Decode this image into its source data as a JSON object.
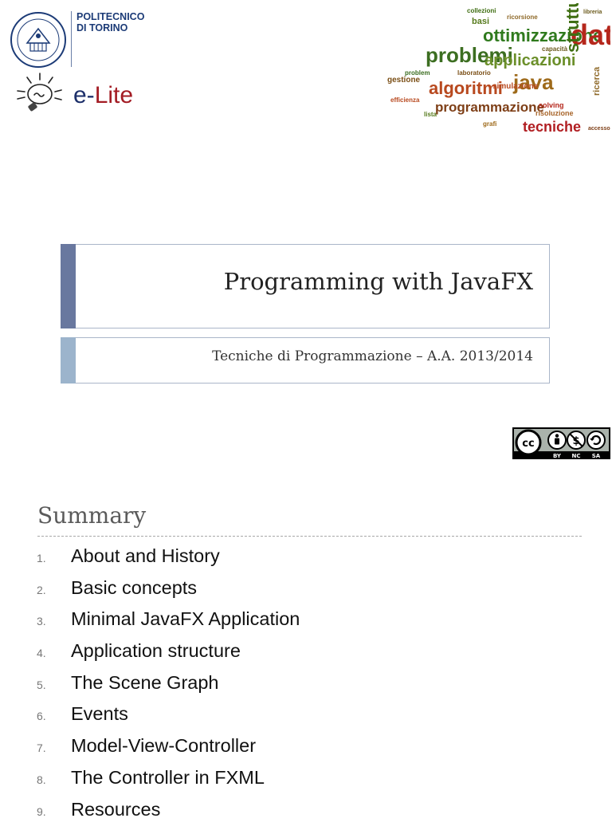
{
  "header": {
    "university_line1": "POLITECNICO",
    "university_line2": "DI TORINO",
    "group_prefix": "e-",
    "group_name": "Lite"
  },
  "word_cloud": {
    "words": [
      "ottimizzazione",
      "dati",
      "problemi",
      "applicazioni",
      "strutture",
      "algoritmi",
      "java",
      "programmazione",
      "tecniche",
      "basi",
      "gestione",
      "simulazione",
      "ricerca",
      "capacità",
      "laboratorio",
      "risoluzione",
      "problem",
      "solving",
      "lista",
      "accesso",
      "libreria",
      "grafi",
      "efficienza",
      "collezioni",
      "ricorsione"
    ]
  },
  "title": {
    "main": "Programming with JavaFX",
    "subtitle": "Tecniche di Programmazione – A.A. 2013/2014"
  },
  "license": {
    "cc": "cc",
    "by": "BY",
    "nc": "NC",
    "sa": "SA"
  },
  "summary": {
    "heading": "Summary",
    "items": [
      {
        "num": "1.",
        "label": "About and History"
      },
      {
        "num": "2.",
        "label": "Basic concepts"
      },
      {
        "num": "3.",
        "label": "Minimal JavaFX Application"
      },
      {
        "num": "4.",
        "label": "Application structure"
      },
      {
        "num": "5.",
        "label": "The Scene Graph"
      },
      {
        "num": "6.",
        "label": "Events"
      },
      {
        "num": "7.",
        "label": "Model-View-Controller"
      },
      {
        "num": "8.",
        "label": "The Controller in FXML"
      },
      {
        "num": "9.",
        "label": "Resources"
      }
    ]
  },
  "colors": {
    "title_accent": "#69789f",
    "subtitle_accent": "#9cb4cc",
    "polito_blue": "#1c3b77",
    "elite_red": "#a31c24"
  }
}
